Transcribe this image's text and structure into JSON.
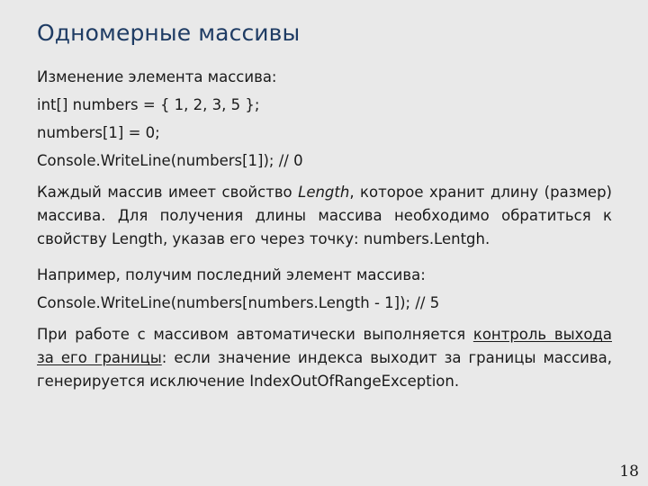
{
  "slide": {
    "title": "Одномерные массивы",
    "title_color": "#1f3c64",
    "background_color": "#e9e9e9",
    "text_color": "#1a1a1a",
    "page_number": "18"
  },
  "content": {
    "intro_label": "Изменение элемента массива:",
    "code_line_1": "int[] numbers = { 1, 2, 3, 5 };",
    "code_line_2": "numbers[1] = 0;",
    "code_line_3": "Console.WriteLine(numbers[1]);  // 0",
    "paragraph_length": {
      "part1": "Каждый массив имеет свойство ",
      "emphasis_italic": "Length",
      "part2": ", которое хранит длину (размер) массива. Для получения длины массива необходимо обратиться к свойству Length, указав его через точку: numbers.Lentgh."
    },
    "example_label": "Например, получим последний элемент массива:",
    "code_line_4": "Console.WriteLine(numbers[numbers.Length - 1]); // 5",
    "paragraph_bounds": {
      "part1": "При работе с массивом автоматически выполняется ",
      "emphasis_underline": "контроль выхода за его границы",
      "part2": ": если значение индекса выходит за границы массива, генерируется исключение IndexOutOfRangeException."
    }
  }
}
